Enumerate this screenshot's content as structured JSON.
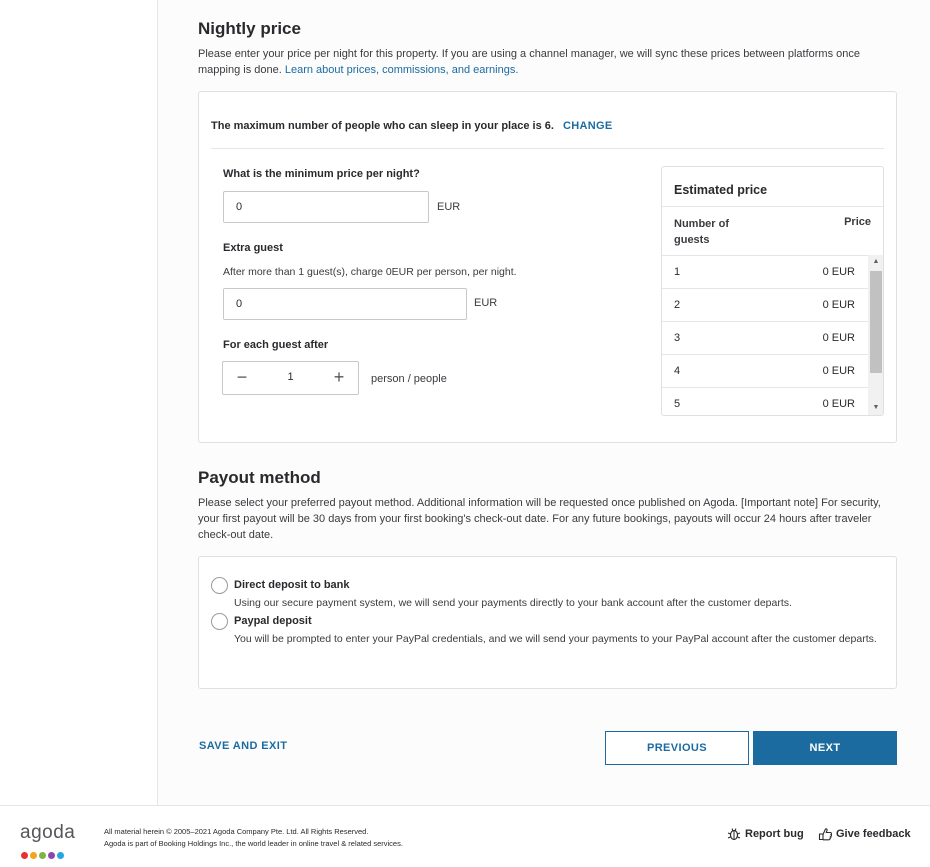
{
  "nightly": {
    "title": "Nightly price",
    "desc_text": "Please enter your price per night for this property. If you are using a channel manager, we will sync these prices between platforms once mapping is done.",
    "desc_link": "Learn about prices, commissions, and earnings.",
    "max_people_text": "The maximum number of people who can sleep in your place is 6.",
    "change_label": "CHANGE",
    "min_price_label": "What is the minimum price per night?",
    "min_price_value": "0",
    "min_price_unit": "EUR",
    "extra_guest_label": "Extra guest",
    "extra_guest_note": "After more than 1 guest(s), charge 0EUR per person, per night.",
    "extra_guest_value": "0",
    "extra_guest_unit": "EUR",
    "each_guest_label": "For each guest after",
    "each_guest_value": "1",
    "each_guest_unit": "person / people",
    "estimated": {
      "title": "Estimated price",
      "col_guests": "Number of guests",
      "col_price": "Price",
      "rows": [
        {
          "guests": "1",
          "price": "0 EUR"
        },
        {
          "guests": "2",
          "price": "0 EUR"
        },
        {
          "guests": "3",
          "price": "0 EUR"
        },
        {
          "guests": "4",
          "price": "0 EUR"
        },
        {
          "guests": "5",
          "price": "0 EUR"
        }
      ]
    }
  },
  "payout": {
    "title": "Payout method",
    "desc": "Please select your preferred payout method. Additional information will be requested once published on Agoda. [Important note] For security, your first payout will be 30 days from your first booking's check-out date. For any future bookings, payouts will occur 24 hours after traveler check-out date.",
    "options": [
      {
        "title": "Direct deposit to bank",
        "desc": "Using our secure payment system, we will send your payments directly to your bank account after the customer departs."
      },
      {
        "title": "Paypal deposit",
        "desc": "You will be prompted to enter your PayPal credentials, and we will send your payments to your PayPal account after the customer departs."
      }
    ]
  },
  "actions": {
    "save_exit": "SAVE AND EXIT",
    "previous": "PREVIOUS",
    "next": "NEXT"
  },
  "footer": {
    "logo_text": "agoda",
    "copyright_line1": "All material herein © 2005–2021 Agoda Company Pte. Ltd. All Rights Reserved.",
    "copyright_line2": "Agoda is part of Booking Holdings Inc., the world leader in online travel & related services.",
    "report_bug": "Report bug",
    "give_feedback": "Give feedback"
  },
  "colors": {
    "accent": "#1b6ba1",
    "logo_dots": [
      "#e8312f",
      "#f4a21f",
      "#7cb342",
      "#8e44ad",
      "#22a7e0"
    ]
  },
  "icons": {
    "stepper_minus": "minus-icon",
    "stepper_plus": "plus-icon",
    "scroll_up": "scroll-up-arrow-icon",
    "scroll_down": "scroll-down-arrow-icon",
    "report_bug": "bug-icon",
    "give_feedback": "feedback-hand-icon"
  }
}
